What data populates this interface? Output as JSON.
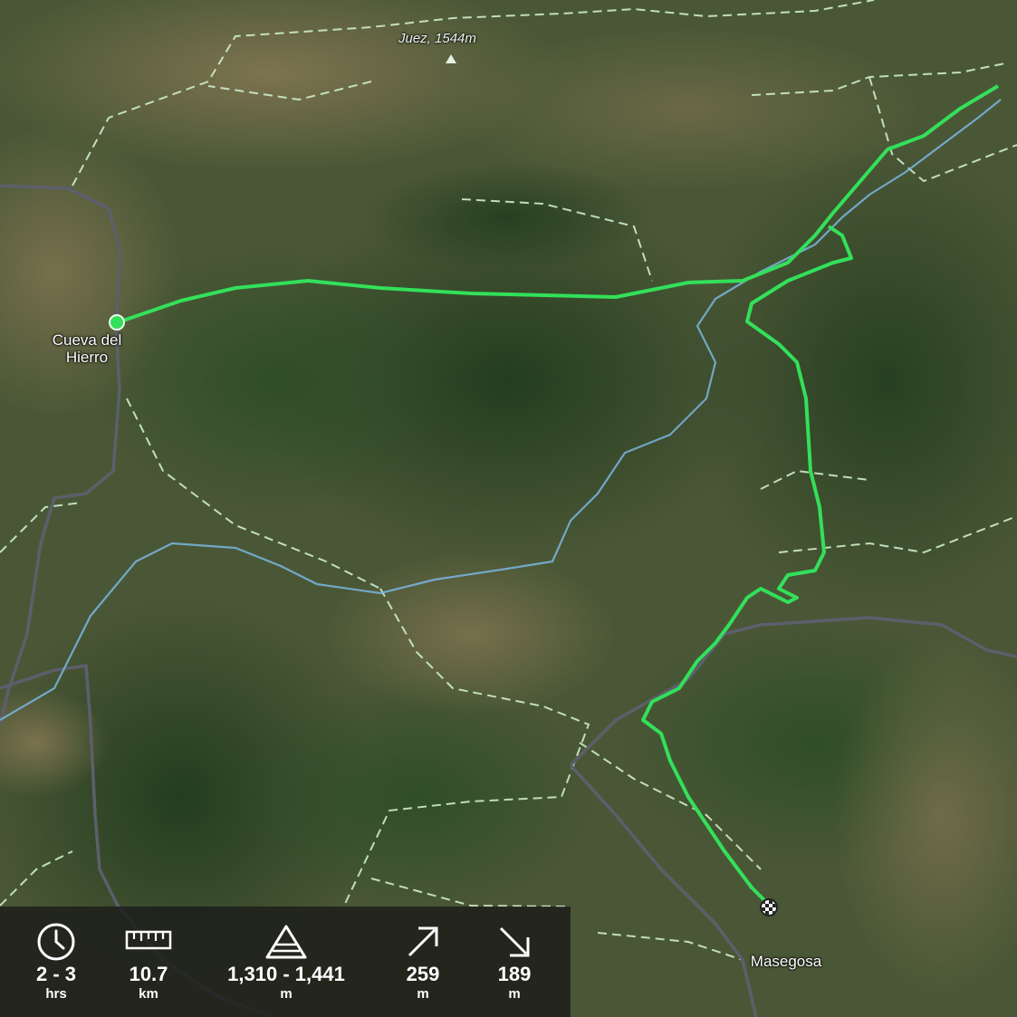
{
  "map": {
    "peak": {
      "label": "Juez, 1544m",
      "icon": "peak-triangle-icon"
    },
    "places": [
      {
        "label_line1": "Cueva del",
        "label_line2": "Hierro"
      },
      {
        "label": "Masegosa"
      }
    ],
    "route_color": "#33e05a",
    "river_color": "#7ab6e0",
    "trail_color": "#cdeecb",
    "road_color": "#5c5f6b",
    "start_marker": "start-dot-icon",
    "finish_marker": "finish-flag-icon"
  },
  "stats": [
    {
      "icon": "clock-icon",
      "value": "2 - 3",
      "unit": "hrs"
    },
    {
      "icon": "ruler-icon",
      "value": "10.7",
      "unit": "km"
    },
    {
      "icon": "elevation-icon",
      "value": "1,310 - 1,441",
      "unit": "m"
    },
    {
      "icon": "ascent-arrow-icon",
      "value": "259",
      "unit": "m"
    },
    {
      "icon": "descent-arrow-icon",
      "value": "189",
      "unit": "m"
    }
  ]
}
